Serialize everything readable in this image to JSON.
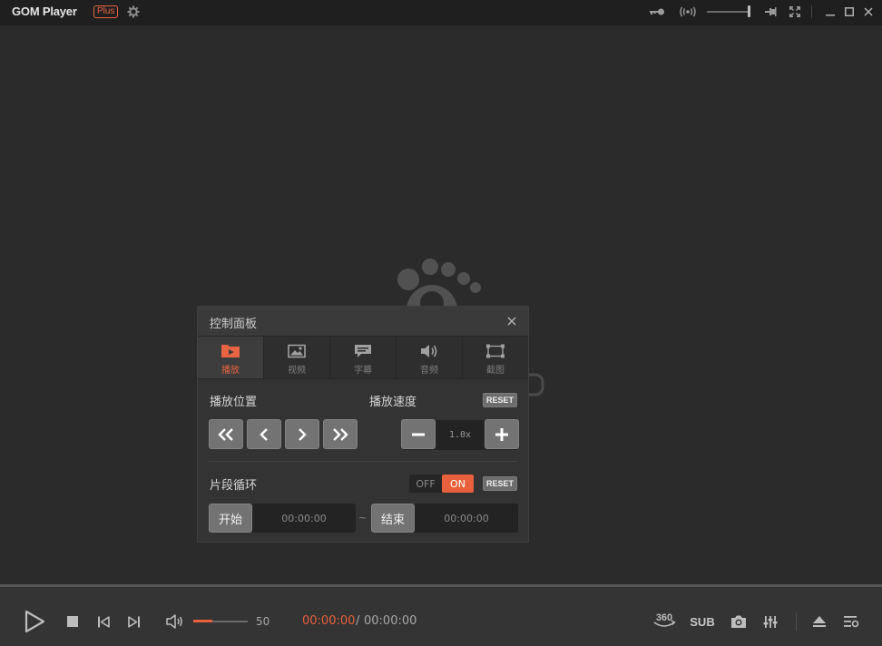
{
  "app": {
    "logo_text": "GOM Player",
    "logo_badge": "Plus"
  },
  "titlebar": {
    "icons": [
      "settings-gear-icon",
      "key-icon",
      "broadcast-icon",
      "pin-icon",
      "fullscreen-icon",
      "minimize-icon",
      "maximize-icon",
      "close-icon"
    ],
    "volume_level": 1.0
  },
  "panel": {
    "title": "控制面板",
    "tabs": [
      {
        "label": "播放",
        "icon": "play-tab-icon",
        "active": true
      },
      {
        "label": "视频",
        "icon": "image-tab-icon",
        "active": false
      },
      {
        "label": "字幕",
        "icon": "subtitle-tab-icon",
        "active": false
      },
      {
        "label": "音频",
        "icon": "speaker-tab-icon",
        "active": false
      },
      {
        "label": "截图",
        "icon": "capture-tab-icon",
        "active": false
      }
    ],
    "position_label": "播放位置",
    "speed_label": "播放速度",
    "reset_label": "RESET",
    "speed_value": "1.0x",
    "loop_label": "片段循环",
    "toggle_off": "OFF",
    "toggle_on": "ON",
    "toggle_state": "ON",
    "start_label": "开始",
    "start_time": "00:00:00",
    "end_label": "结束",
    "end_time": "00:00:00",
    "tilde": "~"
  },
  "bottombar": {
    "volume": "50",
    "volume_fraction": 0.35,
    "time_current": "00:00:00",
    "time_separator": "/",
    "time_total": "00:00:00",
    "vr_label": "360",
    "sub_label": "SUB"
  },
  "colors": {
    "accent": "#e9603d",
    "background": "#2b2b2b",
    "titlebar": "#1f1f1f"
  }
}
